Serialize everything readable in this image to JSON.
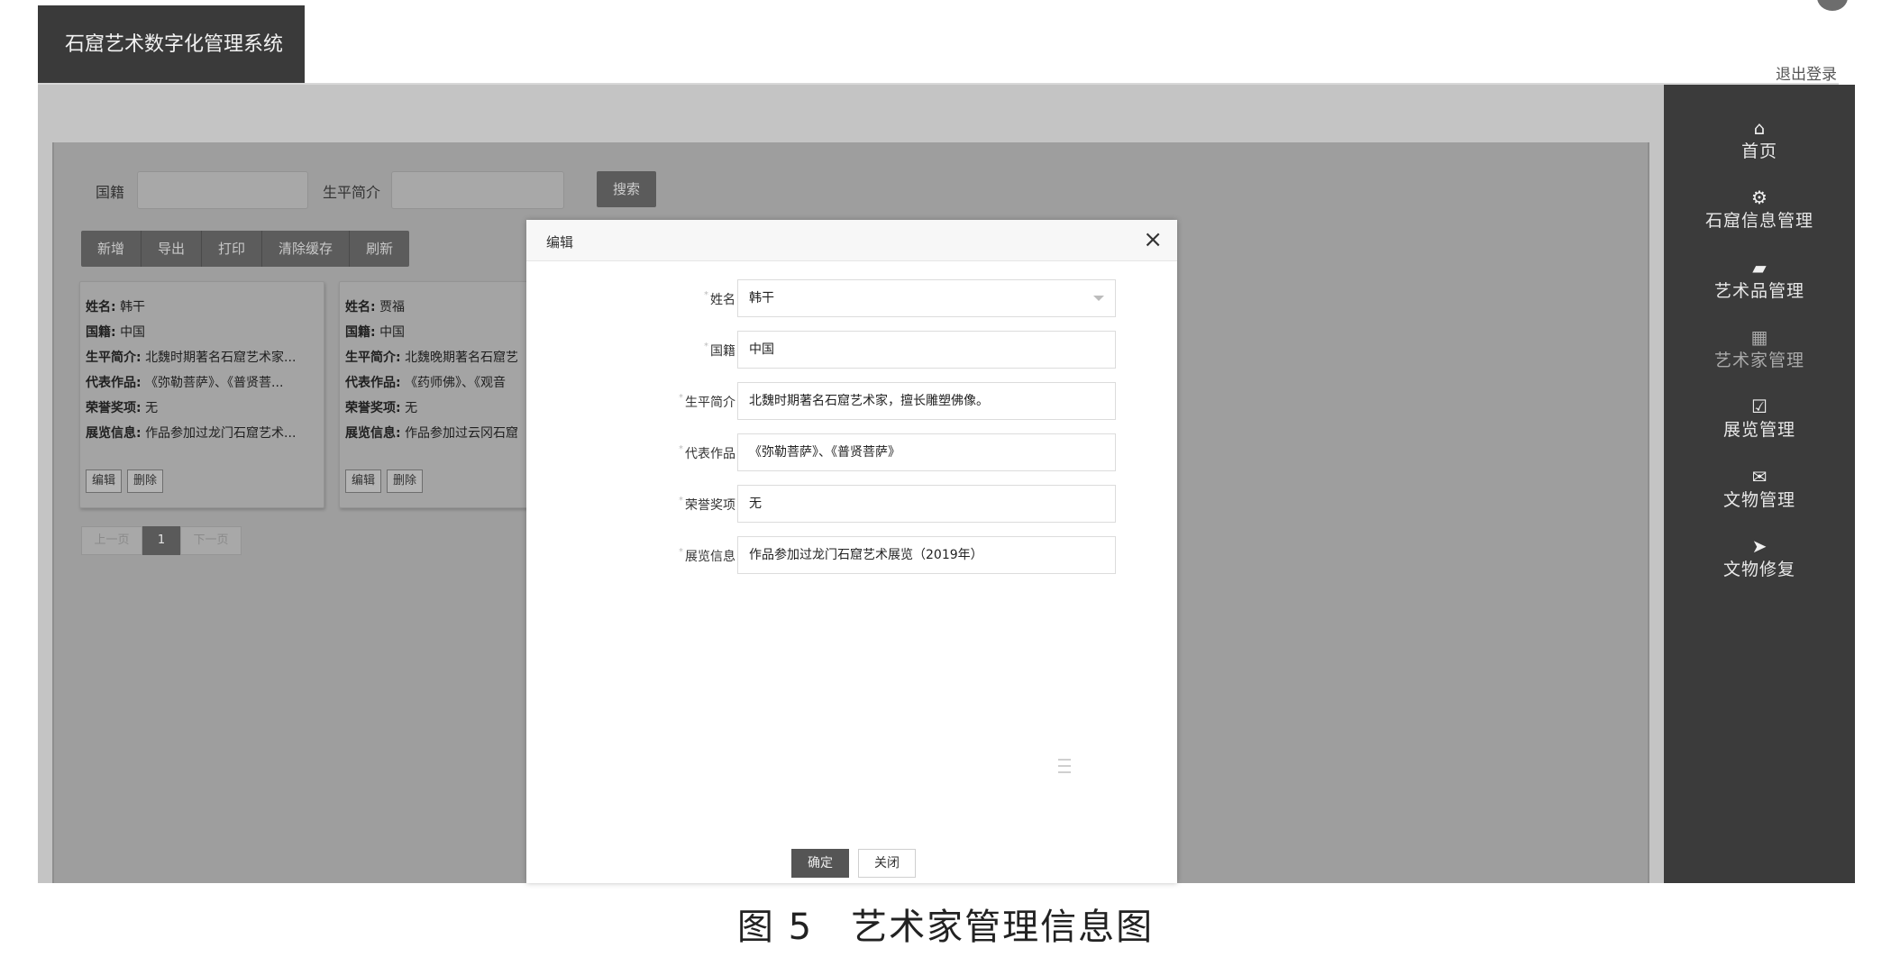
{
  "app": {
    "title": "石窟艺术数字化管理系统",
    "logout": "退出登录"
  },
  "search": {
    "fields": [
      {
        "label": "国籍",
        "value": ""
      },
      {
        "label": "生平简介",
        "value": ""
      }
    ],
    "button": "搜索"
  },
  "toolbar": {
    "buttons": [
      "新增",
      "导出",
      "打印",
      "清除缓存",
      "刷新"
    ]
  },
  "cards": [
    {
      "lines": [
        {
          "k": "姓名:",
          "v": "韩干"
        },
        {
          "k": "国籍:",
          "v": "中国"
        },
        {
          "k": "生平简介:",
          "v": "北魏时期著名石窟艺术家..."
        },
        {
          "k": "代表作品:",
          "v": "《弥勒菩萨》、《普贤菩..."
        },
        {
          "k": "荣誉奖项:",
          "v": "无"
        },
        {
          "k": "展览信息:",
          "v": "作品参加过龙门石窟艺术..."
        }
      ],
      "edit": "编辑",
      "delete": "删除"
    },
    {
      "lines": [
        {
          "k": "姓名:",
          "v": "贾福"
        },
        {
          "k": "国籍:",
          "v": "中国"
        },
        {
          "k": "生平简介:",
          "v": "北魏晚期著名石窟艺"
        },
        {
          "k": "代表作品:",
          "v": "《药师佛》、《观音"
        },
        {
          "k": "荣誉奖项:",
          "v": "无"
        },
        {
          "k": "展览信息:",
          "v": "作品参加过云冈石窟"
        }
      ],
      "edit": "编辑",
      "delete": "删除"
    }
  ],
  "pagination": {
    "prev": "上一页",
    "current": "1",
    "next": "下一页"
  },
  "sidebar": {
    "items": [
      {
        "label": "首页",
        "icon": "home-icon",
        "glyph": "⌂"
      },
      {
        "label": "石窟信息管理",
        "icon": "gears-icon",
        "glyph": "⚙"
      },
      {
        "label": "艺术品管理",
        "icon": "book-icon",
        "glyph": "▰"
      },
      {
        "label": "艺术家管理",
        "icon": "grid-icon",
        "glyph": "▦"
      },
      {
        "label": "展览管理",
        "icon": "check-square-icon",
        "glyph": "☑"
      },
      {
        "label": "文物管理",
        "icon": "envelope-icon",
        "glyph": "✉"
      },
      {
        "label": "文物修复",
        "icon": "send-icon",
        "glyph": "➤"
      }
    ]
  },
  "modal": {
    "title": "编辑",
    "close_glyph": "×",
    "fields": [
      {
        "label": "姓名",
        "value": "韩干"
      },
      {
        "label": "国籍",
        "value": "中国"
      },
      {
        "label": "生平简介",
        "value": "北魏时期著名石窟艺术家，擅长雕塑佛像。"
      },
      {
        "label": "代表作品",
        "value": "《弥勒菩萨》、《普贤菩萨》"
      },
      {
        "label": "荣誉奖项",
        "value": "无"
      },
      {
        "label": "展览信息",
        "value": "作品参加过龙门石窟艺术展览（2019年）"
      }
    ],
    "ok": "确定",
    "close": "关闭"
  },
  "caption": "图 5　艺术家管理信息图"
}
